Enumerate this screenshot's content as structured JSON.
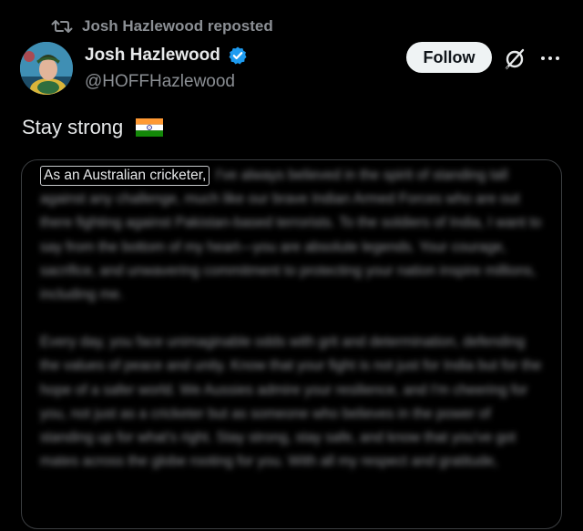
{
  "repost": {
    "icon": "repost-icon",
    "label": "Josh Hazlewood reposted"
  },
  "author": {
    "name": "Josh Hazlewood",
    "handle": "@HOFFHazlewood",
    "verified_icon": "verified-badge-icon",
    "verified_color": "#1d9bf0"
  },
  "actions": {
    "follow_label": "Follow",
    "grok_icon": "grok-icon",
    "more_icon": "more-options-icon"
  },
  "tweet": {
    "text": "Stay strong",
    "flag_icon": "india-flag-icon"
  },
  "card": {
    "highlighted_text": "As an Australian cricketer,",
    "blurred_p1": "I've always believed in the spirit of standing tall against any challenge, much like our brave Indian Armed Forces who are out there fighting against Pakistan-based terrorists. To the soldiers of India, I want to say from the bottom of my heart—you are absolute legends. Your courage, sacrifice, and unwavering commitment to protecting your nation inspire millions, including me.",
    "blurred_p2": "Every day, you face unimaginable odds with grit and determination, defending the values of peace and unity. Know that your fight is not just for India but for the hope of a safer world. We Aussies admire your resilience, and I'm cheering for you, not just as a cricketer but as someone who believes in the power of standing up for what's right. Stay strong, stay safe, and know that you've got mates across the globe rooting for you. With all my respect and gratitude,"
  },
  "colors": {
    "background": "#000000",
    "text_primary": "#e7e9ea",
    "text_secondary": "#8b8f94",
    "card_border": "#3a3d40"
  }
}
